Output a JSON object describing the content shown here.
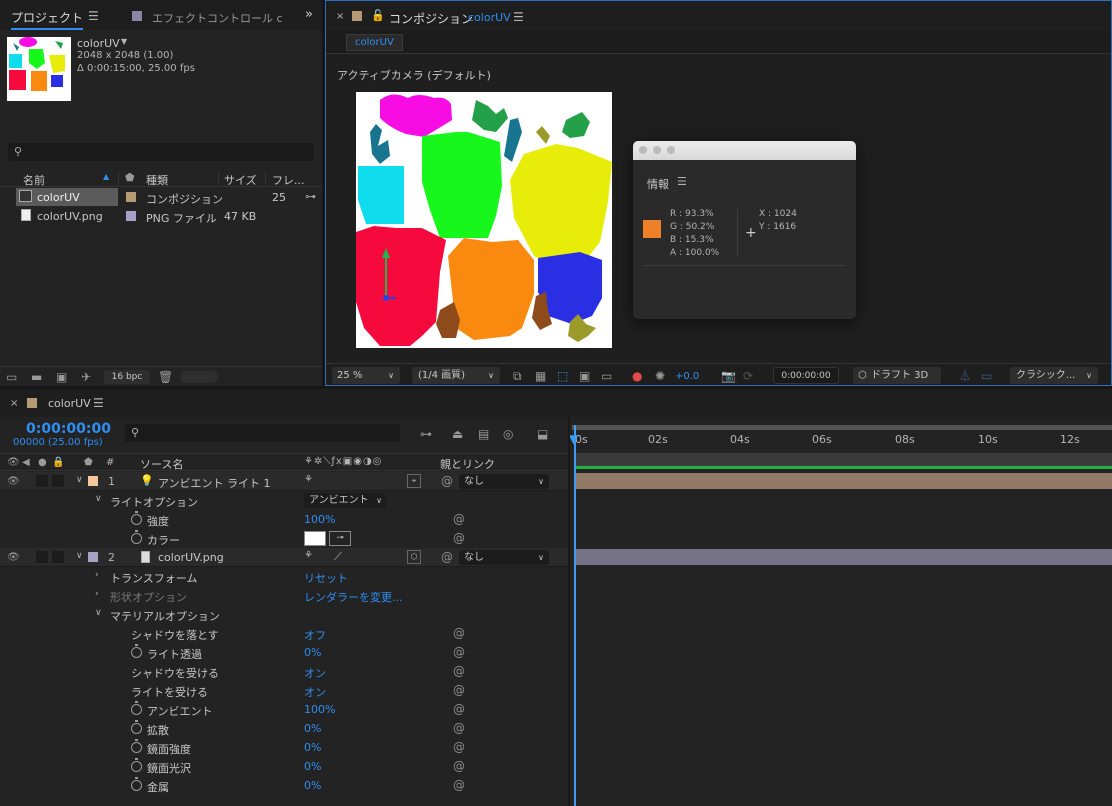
{
  "project": {
    "tab_label": "プロジェクト",
    "effects_tab_label": "エフェクトコントロール c",
    "item_name": "colorUV",
    "item_size": "2048 x 2048 (1.00)",
    "item_duration": "Δ 0:00:15:00, 25.00 fps",
    "search_placeholder": "",
    "col_name": "名前",
    "col_type": "種類",
    "col_size": "サイズ",
    "col_frames": "フレ...",
    "items": [
      {
        "name": "colorUV",
        "type": "コンポジション",
        "size": "",
        "frames": "25",
        "color": "#b59a73"
      },
      {
        "name": "colorUV.png",
        "type": "PNG ファイル",
        "size": "47 KB",
        "frames": "",
        "color": "#a7a1c8"
      }
    ],
    "bpc_label": "16 bpc"
  },
  "composition": {
    "tab_label": "コンポジション",
    "tab_name": "colorUV",
    "sub_tab": "colorUV",
    "view_label": "アクティブカメラ (デフォルト)",
    "zoom": "25 %",
    "resolution": "(1/4 画質)",
    "exposure": "+0.0",
    "timecode": "0:00:00:00",
    "renderer": "ドラフト 3D",
    "view_mode": "クラシック..."
  },
  "info": {
    "title": "情報",
    "r": "R : 93.3%",
    "g": "G : 50.2%",
    "b": "B : 15.3%",
    "a": "A : 100.0%",
    "x": "X : 1024",
    "y": "Y : 1616",
    "swatch_color": "#ee8027"
  },
  "timeline": {
    "tab_name": "colorUV",
    "timecode": "0:00:00:00",
    "frames_fps": "00000 (25.00 fps)",
    "col_source": "ソース名",
    "col_parent": "親とリンク",
    "ruler": [
      "0s",
      "02s",
      "04s",
      "06s",
      "08s",
      "10s",
      "12s"
    ],
    "layers": [
      {
        "num": "1",
        "name": "アンビエント ライト 1",
        "parent": "なし",
        "color": "#f3c79b"
      },
      {
        "num": "2",
        "name": "colorUV.png",
        "parent": "なし",
        "color": "#a7a1c8"
      }
    ],
    "light_options": "ライトオプション",
    "light_type": "アンビエント",
    "intensity_label": "強度",
    "intensity_value": "100%",
    "color_label": "カラー",
    "transform_label": "トランスフォーム",
    "reset_label": "リセット",
    "geometry_label": "形状オプション",
    "renderer_change": "レンダラーを変更...",
    "material_label": "マテリアルオプション",
    "material_props": [
      {
        "label": "シャドウを落とす",
        "value": "オフ",
        "stopwatch": false
      },
      {
        "label": "ライト透過",
        "value": "0%",
        "stopwatch": true
      },
      {
        "label": "シャドウを受ける",
        "value": "オン",
        "stopwatch": false
      },
      {
        "label": "ライトを受ける",
        "value": "オン",
        "stopwatch": false
      },
      {
        "label": "アンビエント",
        "value": "100%",
        "stopwatch": true
      },
      {
        "label": "拡散",
        "value": "0%",
        "stopwatch": true
      },
      {
        "label": "鏡面強度",
        "value": "0%",
        "stopwatch": true
      },
      {
        "label": "鏡面光沢",
        "value": "0%",
        "stopwatch": true
      },
      {
        "label": "金属",
        "value": "0%",
        "stopwatch": true
      }
    ],
    "layer1_bar_color": "#927866",
    "layer2_bar_color": "#767389"
  }
}
